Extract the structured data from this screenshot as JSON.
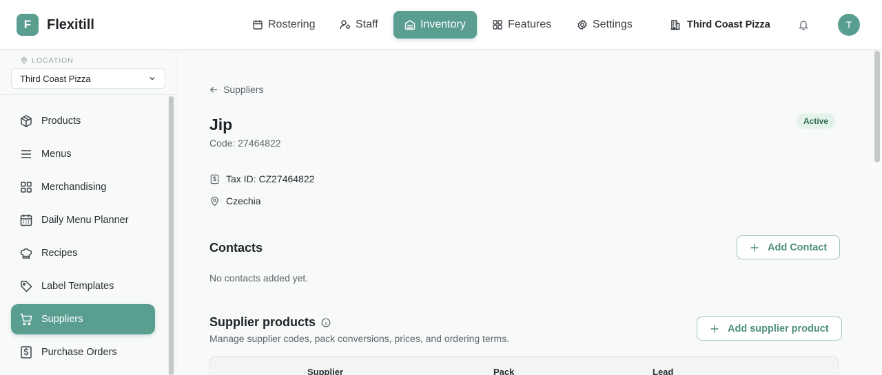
{
  "header": {
    "logo_letter": "F",
    "brand": "Flexitill",
    "nav": [
      {
        "label": "Rostering",
        "icon": "calendar-icon"
      },
      {
        "label": "Staff",
        "icon": "user-gear-icon"
      },
      {
        "label": "Inventory",
        "icon": "box-icon",
        "active": true
      },
      {
        "label": "Features",
        "icon": "grid-icon"
      },
      {
        "label": "Settings",
        "icon": "gear-icon"
      }
    ],
    "location": "Third Coast Pizza",
    "avatar_letter": "T"
  },
  "sidebar": {
    "location_label": "LOCATION",
    "location_value": "Third Coast Pizza",
    "items": [
      {
        "label": "Products",
        "icon": "cube-icon"
      },
      {
        "label": "Menus",
        "icon": "list-icon"
      },
      {
        "label": "Merchandising",
        "icon": "grid-icon"
      },
      {
        "label": "Daily Menu Planner",
        "icon": "calendar-icon"
      },
      {
        "label": "Recipes",
        "icon": "chef-hat-icon"
      },
      {
        "label": "Label Templates",
        "icon": "tag-icon"
      },
      {
        "label": "Suppliers",
        "icon": "cart-icon",
        "active": true
      },
      {
        "label": "Purchase Orders",
        "icon": "dollar-doc-icon"
      }
    ]
  },
  "supplier": {
    "back_label": "Suppliers",
    "name": "Jip",
    "status": "Active",
    "code": "Code: 27464822",
    "tax_id": "Tax ID: CZ27464822",
    "country": "Czechia"
  },
  "contacts": {
    "title": "Contacts",
    "add_label": "Add Contact",
    "empty": "No contacts added yet."
  },
  "supplier_products": {
    "title": "Supplier products",
    "subtitle": "Manage supplier codes, pack conversions, prices, and ordering terms.",
    "add_label": "Add supplier product",
    "columns": [
      "Supplier",
      "Pack",
      "Lead"
    ]
  },
  "colors": {
    "accent": "#5a9e90",
    "badge_bg": "#e3f2ea",
    "badge_text": "#2f6f4f"
  }
}
